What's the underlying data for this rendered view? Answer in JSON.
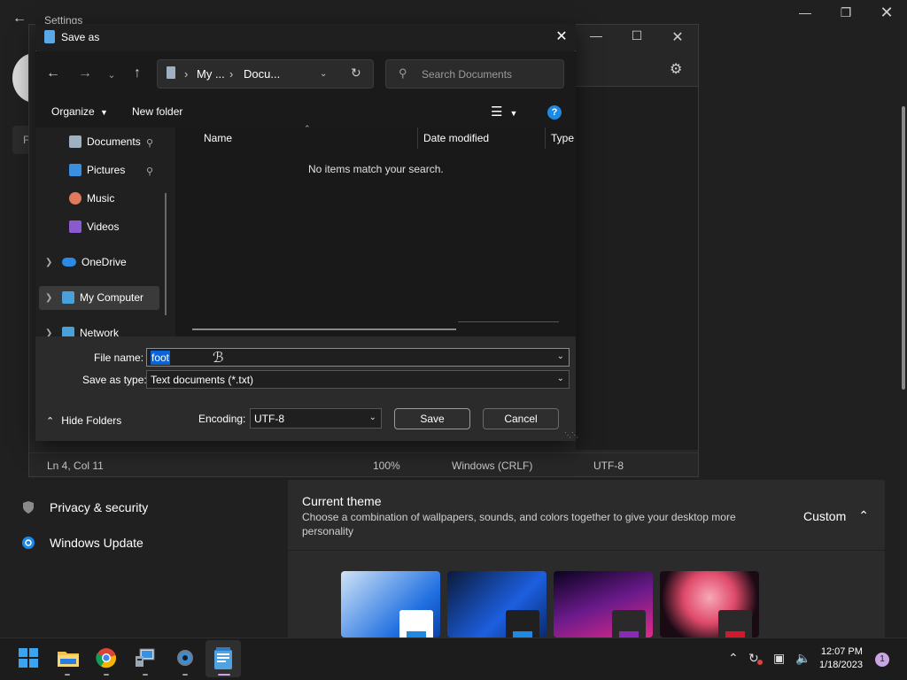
{
  "settings": {
    "title": "Settings",
    "search_stub": "F",
    "nav": [
      {
        "label": "Privacy & security",
        "icon": "shield-icon"
      },
      {
        "label": "Windows Update",
        "icon": "windows-update-icon"
      }
    ],
    "theme": {
      "title": "Current theme",
      "description": "Choose a combination of wallpapers, sounds, and colors together to give your desktop more personality",
      "current": "Custom"
    }
  },
  "notepad": {
    "status": {
      "position": "Ln 4, Col 11",
      "zoom": "100%",
      "line_ending": "Windows (CRLF)",
      "encoding": "UTF-8"
    }
  },
  "dialog": {
    "title": "Save as",
    "breadcrumb": [
      "My ...",
      "Docu..."
    ],
    "search_placeholder": "Search Documents",
    "organize_label": "Organize",
    "new_folder_label": "New folder",
    "help_label": "?",
    "nav_items": [
      {
        "label": "Documents",
        "pinned": true
      },
      {
        "label": "Pictures",
        "pinned": true
      },
      {
        "label": "Music",
        "pinned": false
      },
      {
        "label": "Videos",
        "pinned": false
      },
      {
        "label": "OneDrive",
        "pinned": false
      },
      {
        "label": "My Computer",
        "pinned": false
      },
      {
        "label": "Network",
        "pinned": false
      }
    ],
    "columns": [
      "Name",
      "Date modified",
      "Type"
    ],
    "empty_message": "No items match your search.",
    "file_name_label": "File name:",
    "file_name_value": "foot",
    "save_type_label": "Save as type:",
    "save_type_value": "Text documents (*.txt)",
    "encoding_label": "Encoding:",
    "encoding_value": "UTF-8",
    "save_label": "Save",
    "cancel_label": "Cancel",
    "hide_folders_label": "Hide Folders"
  },
  "taskbar": {
    "apps": [
      "start-icon",
      "file-explorer-icon",
      "chrome-icon",
      "remote-desktop-icon",
      "settings-icon",
      "notepad-icon"
    ],
    "time": "12:07 PM",
    "date": "1/18/2023",
    "notification_count": "1"
  }
}
